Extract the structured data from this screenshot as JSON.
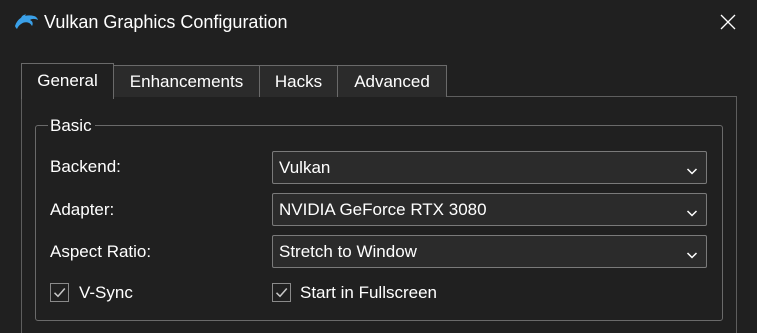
{
  "window": {
    "title": "Vulkan Graphics Configuration",
    "app_icon": "dolphin-icon",
    "close_icon": "close-icon"
  },
  "tabs": [
    {
      "label": "General",
      "active": true
    },
    {
      "label": "Enhancements",
      "active": false
    },
    {
      "label": "Hacks",
      "active": false
    },
    {
      "label": "Advanced",
      "active": false
    }
  ],
  "basic": {
    "group_title": "Basic",
    "backend": {
      "label": "Backend:",
      "value": "Vulkan"
    },
    "adapter": {
      "label": "Adapter:",
      "value": "NVIDIA GeForce RTX 3080"
    },
    "aspect_ratio": {
      "label": "Aspect Ratio:",
      "value": "Stretch to Window"
    },
    "vsync": {
      "label": "V-Sync",
      "checked": true
    },
    "fullscreen": {
      "label": "Start in Fullscreen",
      "checked": true
    }
  },
  "colors": {
    "accent": "#3aa0e8",
    "background": "#202020",
    "control_bg": "#2b2b2b",
    "border": "#7a7a7a"
  }
}
